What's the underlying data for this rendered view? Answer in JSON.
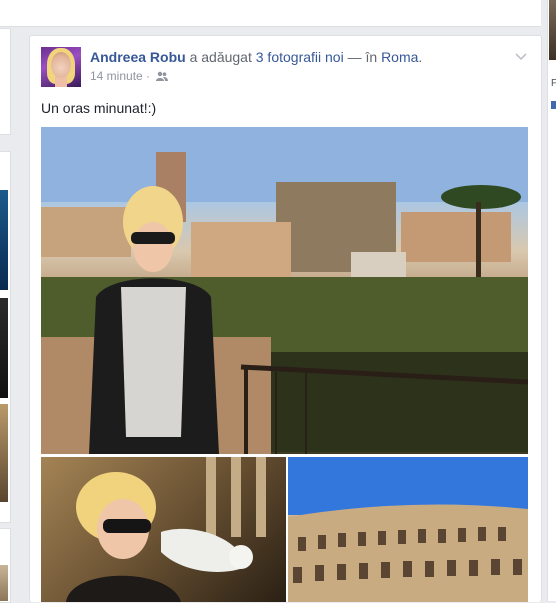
{
  "post": {
    "author": "Andreea Robu",
    "action_prefix": " a adăugat ",
    "action_link": "3 fotografii noi",
    "location_prefix": " — în ",
    "location": "Roma",
    "location_suffix": ".",
    "timestamp": "14 minute",
    "separator": " · ",
    "status_text": "Un oras minunat!:)",
    "audience_icon": "friends-icon",
    "menu_icon": "chevron-down-icon"
  },
  "right_column": {
    "label": "F"
  },
  "colors": {
    "link_blue": "#365899",
    "background": "#e9ebee",
    "text_gray": "#616770",
    "meta_gray": "#90949c"
  }
}
